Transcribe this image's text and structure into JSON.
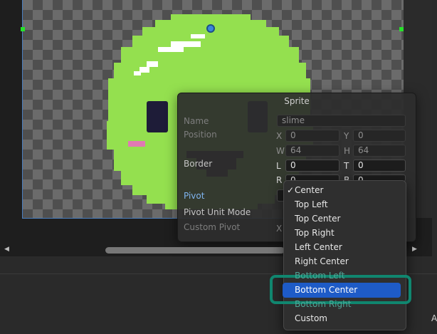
{
  "panel": {
    "title": "Sprite",
    "name_label": "Name",
    "name_value": "slime",
    "position_label": "Position",
    "x_label": "X",
    "x_value": "0",
    "y_label": "Y",
    "y_value": "0",
    "w_label": "W",
    "w_value": "64",
    "h_label": "H",
    "h_value": "64",
    "border_label": "Border",
    "l_label": "L",
    "l_value": "0",
    "t_label": "T",
    "t_value": "0",
    "r_label": "R",
    "r_value": "0",
    "b_label": "B",
    "b_value": "0",
    "pivot_label": "Pivot",
    "pivot_unit_label": "Pivot Unit Mode",
    "custom_pivot_label": "Custom Pivot",
    "custom_x_label": "X"
  },
  "pivot_menu": {
    "items": [
      {
        "label": "Center",
        "checked": true
      },
      {
        "label": "Top Left"
      },
      {
        "label": "Top Center"
      },
      {
        "label": "Top Right"
      },
      {
        "label": "Left Center"
      },
      {
        "label": "Right Center"
      },
      {
        "label": "Bottom Left"
      },
      {
        "label": "Bottom Center",
        "selected": true
      },
      {
        "label": "Bottom Right"
      },
      {
        "label": "Custom"
      }
    ],
    "checkmark": "✓"
  },
  "scroll": {
    "left_arrow": "◀",
    "right_arrow": "▶"
  },
  "bottom": {
    "right_glyph": "A"
  },
  "colors": {
    "slime_green": "#94e04f",
    "eye": "#1e1c38",
    "blush": "#e07ab3",
    "highlight_ring": "#10866f",
    "selection": "#1e5bc7",
    "accent_label": "#7fb4ef"
  },
  "icons": [
    "pivot-handle-icon",
    "checkmark-icon",
    "scroll-left-icon",
    "scroll-right-icon"
  ]
}
